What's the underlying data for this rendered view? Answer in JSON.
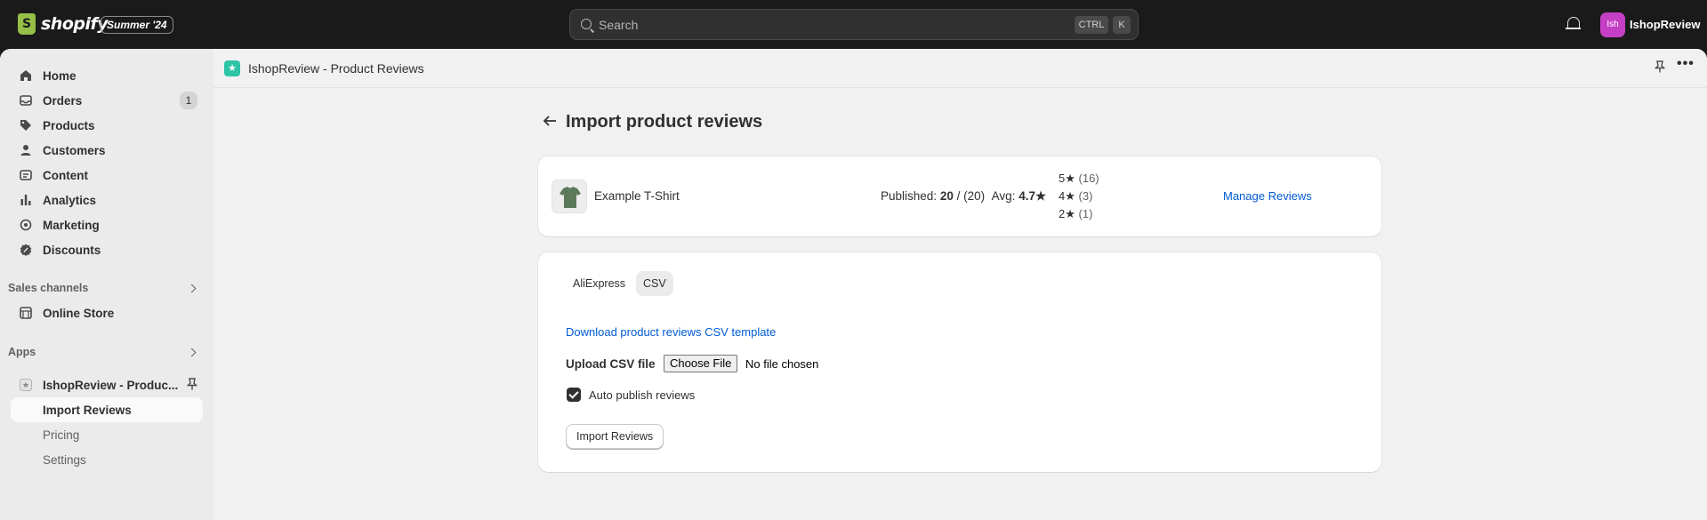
{
  "topbar": {
    "brand": "shopify",
    "edition": "Summer '24",
    "search_placeholder": "Search",
    "shortcut_ctrl": "CTRL",
    "shortcut_key": "K",
    "avatar_initials": "Ish",
    "store_name": "IshopReview"
  },
  "sidebar": {
    "items": [
      {
        "label": "Home",
        "icon": "home-icon"
      },
      {
        "label": "Orders",
        "icon": "inbox-icon",
        "badge": "1"
      },
      {
        "label": "Products",
        "icon": "tag-icon"
      },
      {
        "label": "Customers",
        "icon": "person-icon"
      },
      {
        "label": "Content",
        "icon": "content-icon"
      },
      {
        "label": "Analytics",
        "icon": "bar-chart-icon"
      },
      {
        "label": "Marketing",
        "icon": "target-icon"
      },
      {
        "label": "Discounts",
        "icon": "discount-icon"
      }
    ],
    "sales_channels_label": "Sales channels",
    "online_store_label": "Online Store",
    "apps_label": "Apps",
    "app_name": "IshopReview - Produc...",
    "app_subitems": [
      "Import Reviews",
      "Pricing",
      "Settings"
    ]
  },
  "appbar": {
    "title": "IshopReview - Product Reviews"
  },
  "page": {
    "title": "Import product reviews"
  },
  "product": {
    "name": "Example T-Shirt",
    "published_label": "Published:",
    "published_count": "20",
    "published_total": "/ (20)",
    "avg_label": "Avg:",
    "avg_value": "4.7★",
    "ratings": [
      {
        "stars": "5★",
        "count": "(16)"
      },
      {
        "stars": "4★",
        "count": "(3)"
      },
      {
        "stars": "2★",
        "count": "(1)"
      }
    ],
    "manage_link": "Manage Reviews"
  },
  "import": {
    "tabs": [
      "AliExpress",
      "CSV"
    ],
    "active_tab": "CSV",
    "download_link": "Download product reviews CSV template",
    "upload_label": "Upload CSV file",
    "choose_file": "Choose File",
    "no_file": "No file chosen",
    "auto_publish_label": "Auto publish reviews",
    "auto_publish_checked": true,
    "import_button": "Import Reviews"
  }
}
